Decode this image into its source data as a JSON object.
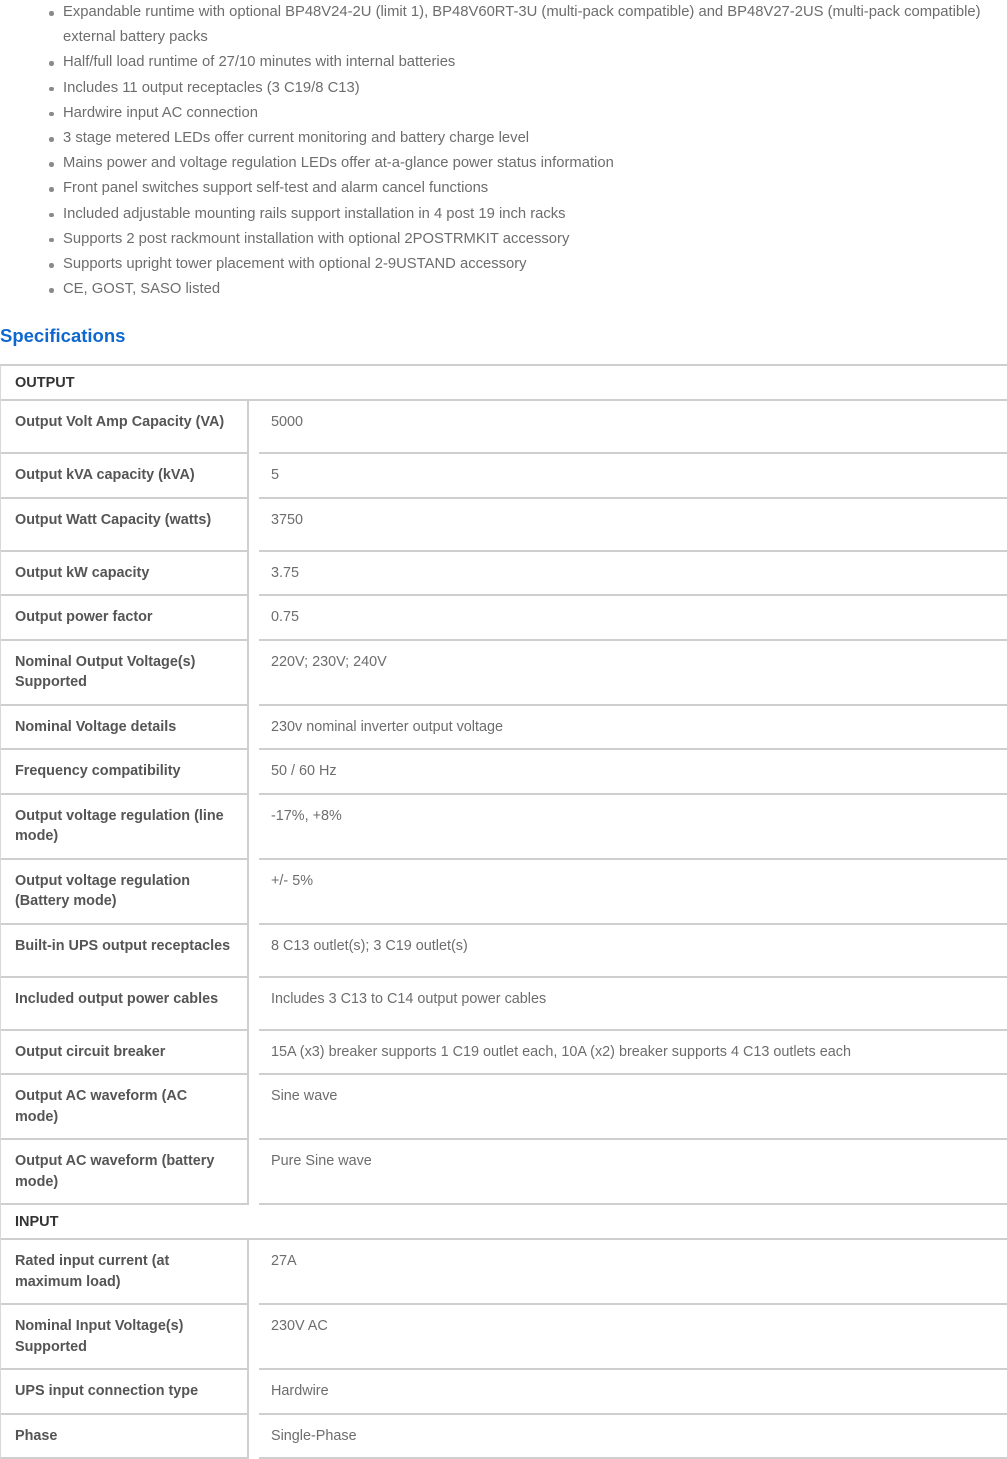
{
  "features": [
    "Expandable runtime with optional BP48V24-2U (limit 1), BP48V60RT-3U (multi-pack compatible) and BP48V27-2US (multi-pack compatible) external battery packs",
    "Half/full load runtime of 27/10 minutes with internal batteries",
    "Includes 11 output receptacles (3 C19/8 C13)",
    "Hardwire input AC connection",
    "3 stage metered LEDs offer current monitoring and battery charge level",
    "Mains power and voltage regulation LEDs offer at-a-glance power status information",
    "Front panel switches support self-test and alarm cancel functions",
    "Included adjustable mounting rails support installation in 4 post 19 inch racks",
    "Supports 2 post rackmount installation with optional 2POSTRMKIT accessory",
    "Supports upright tower placement with optional 2-9USTAND accessory",
    "CE, GOST, SASO listed"
  ],
  "specifications": {
    "heading": "Specifications",
    "accent_color": "#0f68cf",
    "sections": [
      {
        "title": "OUTPUT",
        "rows": [
          {
            "label": "Output Volt Amp Capacity (VA)",
            "value": "5000",
            "size": "tall"
          },
          {
            "label": "Output kVA capacity (kVA)",
            "value": "5",
            "size": "short"
          },
          {
            "label": "Output Watt Capacity (watts)",
            "value": "3750",
            "size": "tall"
          },
          {
            "label": "Output kW capacity",
            "value": "3.75",
            "size": "short"
          },
          {
            "label": "Output power factor",
            "value": "0.75",
            "size": "short"
          },
          {
            "label": "Nominal Output Voltage(s) Supported",
            "value": "220V; 230V; 240V",
            "size": "tall"
          },
          {
            "label": "Nominal Voltage details",
            "value": "230v nominal inverter output voltage",
            "size": "short"
          },
          {
            "label": "Frequency compatibility",
            "value": "50 / 60 Hz",
            "size": "short"
          },
          {
            "label": "Output voltage regulation (line mode)",
            "value": "-17%, +8%",
            "size": "tall"
          },
          {
            "label": "Output voltage regulation (Battery mode)",
            "value": "+/- 5%",
            "size": "tall"
          },
          {
            "label": "Built-in UPS output receptacles",
            "value": "8 C13 outlet(s); 3 C19 outlet(s)",
            "size": "tall"
          },
          {
            "label": "Included output power cables",
            "value": "Includes 3 C13 to C14 output power cables",
            "size": "tall"
          },
          {
            "label": "Output circuit breaker",
            "value": "15A (x3) breaker supports 1 C19 outlet each, 10A (x2) breaker supports 4 C13 outlets each",
            "size": "short"
          },
          {
            "label": "Output AC waveform (AC mode)",
            "value": "Sine wave",
            "size": "tall"
          },
          {
            "label": "Output AC waveform (battery mode)",
            "value": "Pure Sine wave",
            "size": "tall"
          }
        ]
      },
      {
        "title": "INPUT",
        "rows": [
          {
            "label": "Rated input current (at maximum load)",
            "value": "27A",
            "size": "tall"
          },
          {
            "label": "Nominal Input Voltage(s) Supported",
            "value": "230V AC",
            "size": "tall"
          },
          {
            "label": "UPS input connection type",
            "value": "Hardwire",
            "size": "short"
          },
          {
            "label": "Phase",
            "value": "Single-Phase",
            "size": "short"
          }
        ]
      }
    ]
  }
}
